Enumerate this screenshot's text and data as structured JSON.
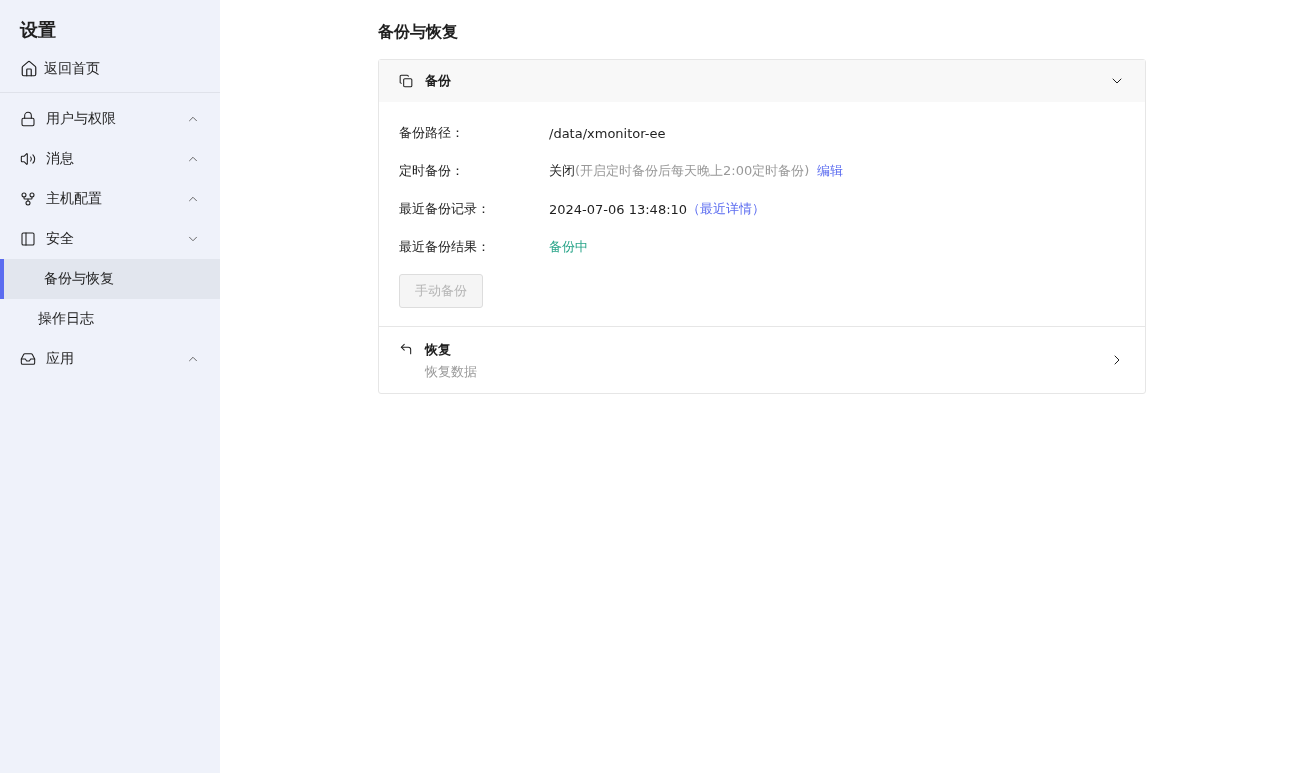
{
  "sidebar": {
    "title": "设置",
    "home": "返回首页",
    "groups": [
      {
        "label": "用户与权限",
        "expanded": false
      },
      {
        "label": "消息",
        "expanded": false
      },
      {
        "label": "主机配置",
        "expanded": false
      },
      {
        "label": "安全",
        "expanded": true,
        "children": [
          {
            "label": "备份与恢复",
            "selected": true
          },
          {
            "label": "操作日志",
            "selected": false
          }
        ]
      },
      {
        "label": "应用",
        "expanded": false
      }
    ]
  },
  "page": {
    "title": "备份与恢复",
    "panels": [
      {
        "title": "备份",
        "expanded": true,
        "fields": [
          {
            "label": "备份路径：",
            "kind": "plain",
            "value": "/data/xmonitor-ee"
          },
          {
            "label": "定时备份：",
            "kind": "plain",
            "value": "关闭",
            "note": "(开启定时备份后每天晚上2:00定时备份)",
            "link": "编辑"
          },
          {
            "label": "最近备份记录：",
            "kind": "plain",
            "value": "2024-07-06 13:48:10",
            "link": "（最近详情）"
          },
          {
            "label": "最近备份结果：",
            "kind": "status",
            "value": "备份中"
          }
        ],
        "button": {
          "label": "手动备份",
          "disabled": true
        }
      },
      {
        "title": "恢复",
        "expanded": false,
        "subtitle": "恢复数据"
      }
    ]
  }
}
